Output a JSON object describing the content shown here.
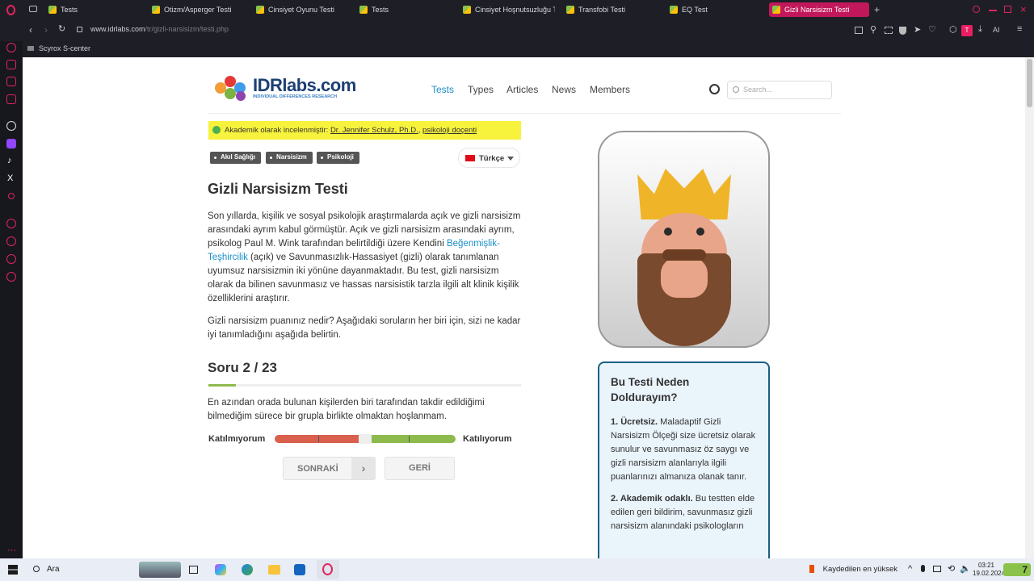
{
  "browser": {
    "tabs": [
      {
        "label": "Tests"
      },
      {
        "label": "Otizm/Asperger Testi"
      },
      {
        "label": "Cinsiyet Oyunu Testi"
      },
      {
        "label": "Tests"
      },
      {
        "label": "Cinsiyet Hoşnutsuzluğu Te"
      },
      {
        "label": "Transfobi Testi"
      },
      {
        "label": "EQ Test"
      },
      {
        "label": "Gizli Narsisizm Testi"
      }
    ],
    "url_domain": "www.idrlabs.com",
    "url_path": "/tr/gizli-narsisizm/testi.php",
    "bookmark": "Scyrox S-center",
    "profile_letter": "T",
    "ai_label": "AI"
  },
  "site": {
    "logo_main": "IDRlabs.com",
    "logo_sub": "INDIVIDUAL DIFFERENCES RESEARCH",
    "nav": [
      "Tests",
      "Types",
      "Articles",
      "News",
      "Members"
    ],
    "search_placeholder": "Search..."
  },
  "review": {
    "prefix": "Akademik olarak incelenmiştir:",
    "reviewer": "Dr. Jennifer Schulz, Ph.D.",
    "separator": ",",
    "role": "psikoloji doçenti"
  },
  "tags": [
    "Akıl Sağlığı",
    "Narsisizm",
    "Psikoloji"
  ],
  "language": "Türkçe",
  "title": "Gizli Narsisizm Testi",
  "intro": {
    "p1_before": "Son yıllarda, kişilik ve sosyal psikolojik araştırmalarda açık ve gizli narsisizm arasındaki ayrım kabul görmüştür. Açık ve gizli narsisizm arasındaki ayrım, psikolog Paul M. Wink tarafından belirtildiği üzere Kendini",
    "p1_link": "Beğenmişlik-Teşhircilik",
    "p1_after": "(açık) ve Savunmasızlık-Hassasiyet (gizli) olarak tanımlanan uyumsuz narsisizmin iki yönüne dayanmaktadır. Bu test, gizli narsisizm olarak da bilinen savunmasız ve hassas narsisistik tarzla ilgili alt klinik kişilik özelliklerini araştırır.",
    "p2": "Gizli narsisizm puanınız nedir? Aşağıdaki soruların her biri için, sizi ne kadar iyi tanımladığını aşağıda belirtin."
  },
  "question": {
    "counter": "Soru 2 / 23",
    "current": 2,
    "total": 23,
    "text": "En azından orada bulunan kişilerden biri tarafından takdir edildiğimi bilmediğim sürece bir grupla birlikte olmaktan hoşlanmam.",
    "left_label": "Katılmıyorum",
    "right_label": "Katılıyorum",
    "next": "SONRAKİ",
    "back": "GERİ"
  },
  "sidebar": {
    "heading": "Bu Testi Neden Doldurayım?",
    "item1_title": "1. Ücretsiz.",
    "item1_text": "Maladaptif Gizli Narsisizm Ölçeği size ücretsiz olarak sunulur ve savunmasız öz saygı ve gizli narsisizm alanlarıyla ilgili puanlarınızı almanıza olanak tanır.",
    "item2_title": "2. Akademik odaklı.",
    "item2_text": "Bu testten elde edilen geri bildirim, savunmasız gizli narsisizm alanındaki psikologların"
  },
  "taskbar": {
    "search": "Ara",
    "notification": "Kaydedilen en yüksek",
    "time": "03:21",
    "date": "19.02.2024",
    "badge": "7"
  },
  "colors": {
    "accent": "#c2185b",
    "link": "#1a8fc9",
    "slider_red": "#d9604d",
    "slider_green": "#8dba4d",
    "review_bg": "#f7f23b",
    "sidebar_border": "#1c5f82"
  }
}
